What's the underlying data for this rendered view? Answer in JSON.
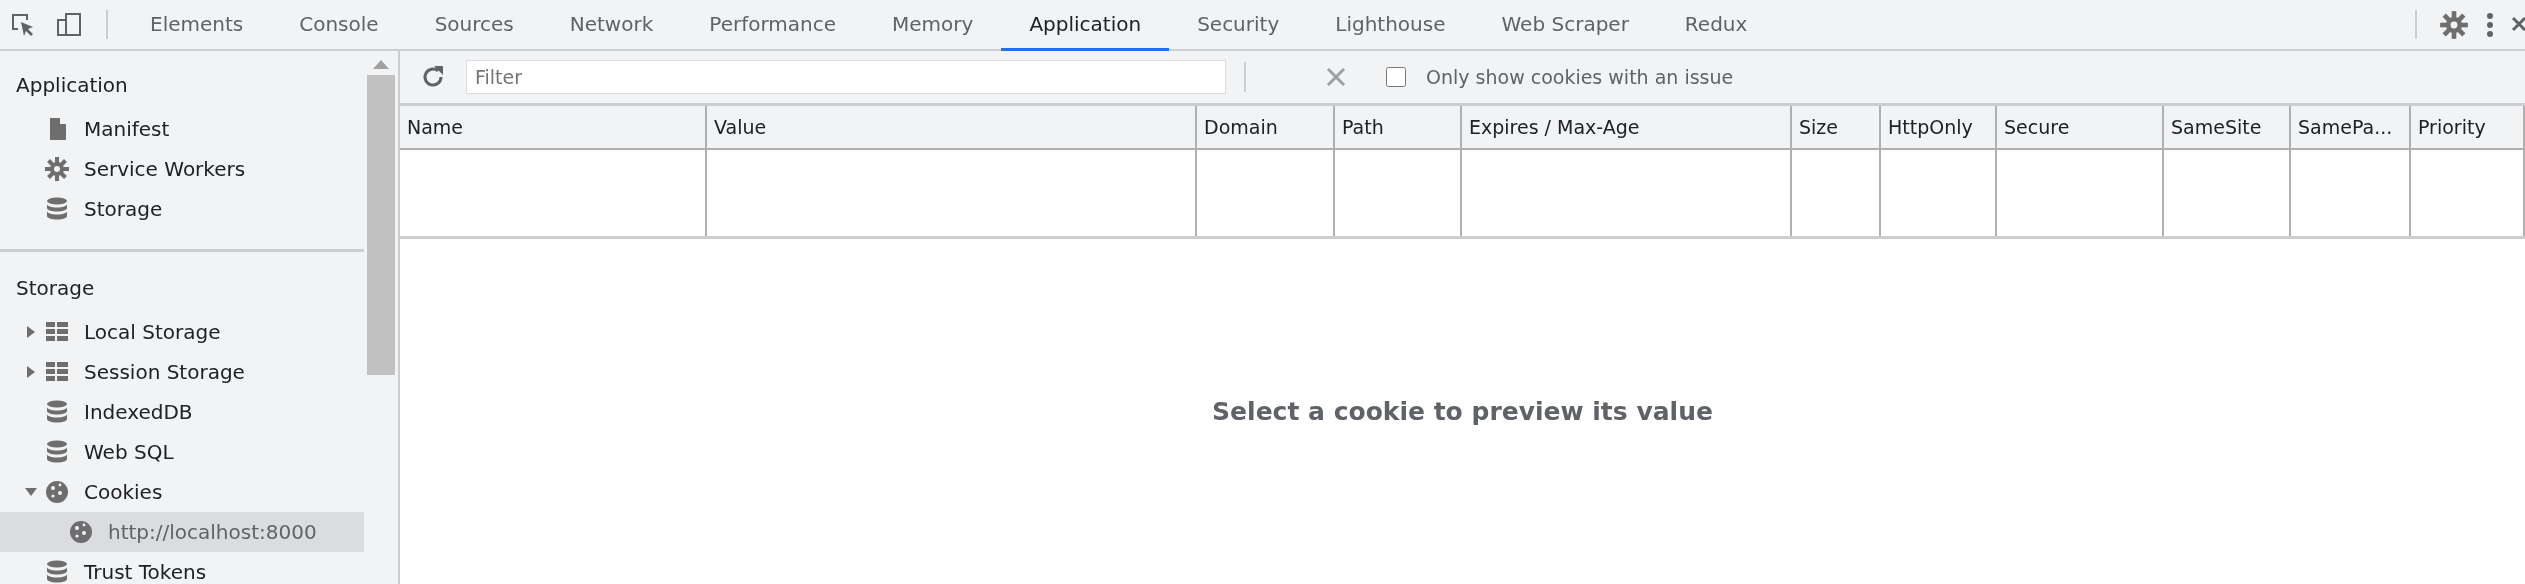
{
  "tabs": [
    {
      "label": "Elements",
      "selected": false
    },
    {
      "label": "Console",
      "selected": false
    },
    {
      "label": "Sources",
      "selected": false
    },
    {
      "label": "Network",
      "selected": false
    },
    {
      "label": "Performance",
      "selected": false
    },
    {
      "label": "Memory",
      "selected": false
    },
    {
      "label": "Application",
      "selected": true
    },
    {
      "label": "Security",
      "selected": false
    },
    {
      "label": "Lighthouse",
      "selected": false
    },
    {
      "label": "Web Scraper",
      "selected": false
    },
    {
      "label": "Redux",
      "selected": false
    }
  ],
  "sidebar": {
    "sections": [
      {
        "title": "Application",
        "items": [
          {
            "label": "Manifest",
            "kind": "file",
            "selected": false
          },
          {
            "label": "Service Workers",
            "kind": "gear",
            "selected": false
          },
          {
            "label": "Storage",
            "kind": "database",
            "selected": false
          }
        ]
      },
      {
        "title": "Storage",
        "items": [
          {
            "label": "Local Storage",
            "kind": "table",
            "expanded": false,
            "selected": false
          },
          {
            "label": "Session Storage",
            "kind": "table",
            "expanded": false,
            "selected": false
          },
          {
            "label": "IndexedDB",
            "kind": "database",
            "selected": false
          },
          {
            "label": "Web SQL",
            "kind": "database",
            "selected": false
          },
          {
            "label": "Cookies",
            "kind": "cookie",
            "expanded": true,
            "selected": false,
            "children": [
              {
                "label": "http://localhost:8000",
                "kind": "cookie",
                "selected": true
              }
            ]
          },
          {
            "label": "Trust Tokens",
            "kind": "database",
            "selected": false
          }
        ]
      }
    ]
  },
  "toolbar": {
    "filter": {
      "placeholder": "Filter"
    },
    "only_issues": {
      "label": "Only show cookies with an issue",
      "checked": false
    }
  },
  "table": {
    "columns": [
      "Name",
      "Value",
      "Domain",
      "Path",
      "Expires / Max-Age",
      "Size",
      "HttpOnly",
      "Secure",
      "SameSite",
      "SamePa...",
      "Priority"
    ]
  },
  "preview": {
    "message": "Select a cookie to preview its value"
  }
}
